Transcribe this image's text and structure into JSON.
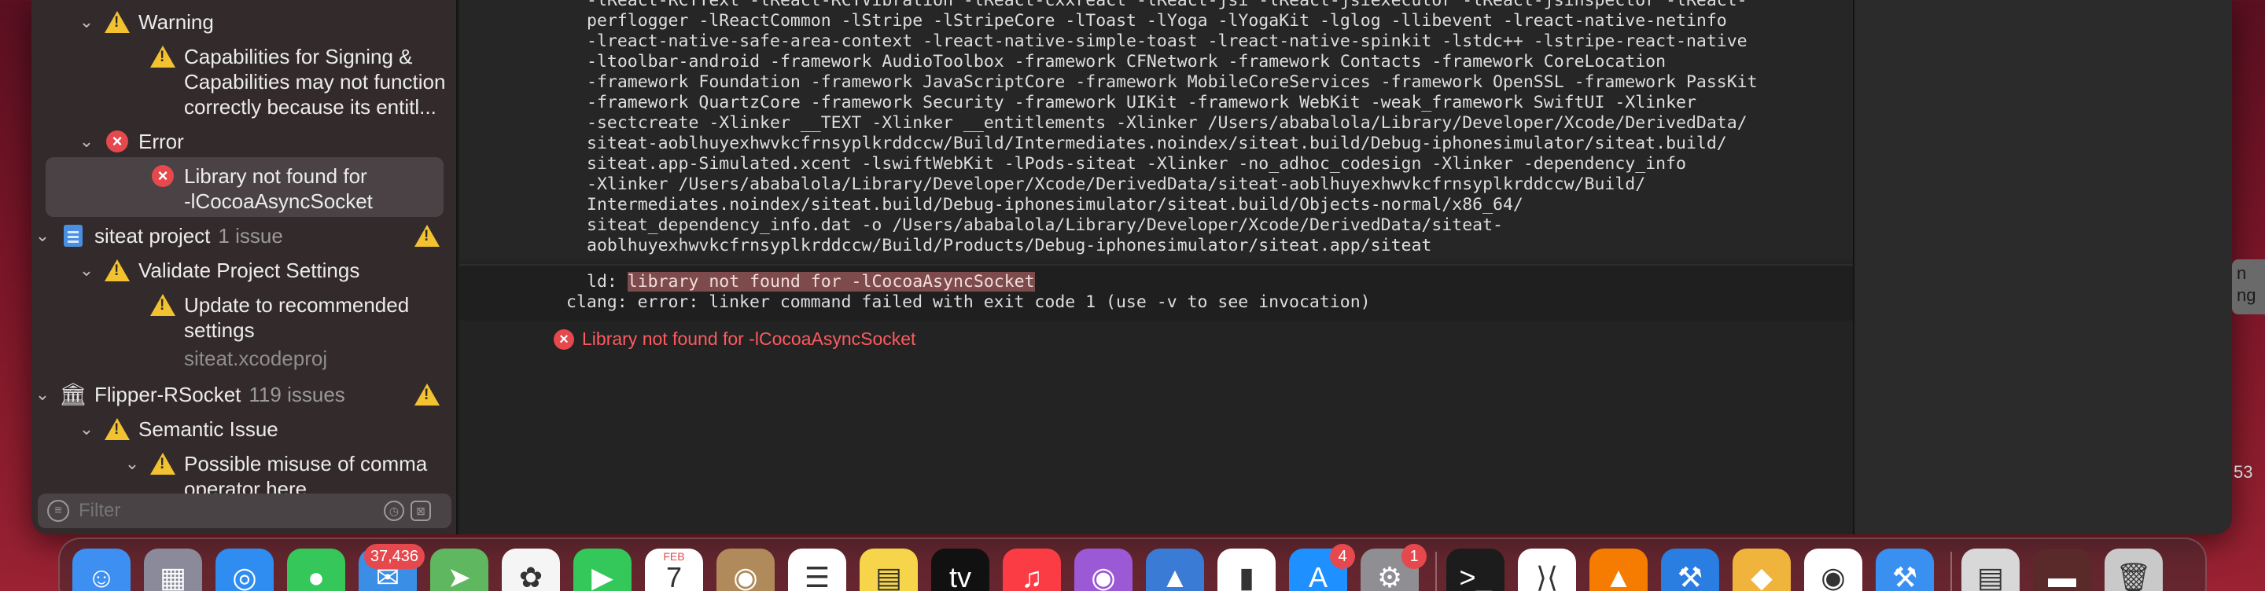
{
  "navigator": {
    "rows": [
      {
        "kind": "group",
        "chevron": "⌄",
        "icon": "warning-icon",
        "label": "Warning"
      },
      {
        "kind": "issue",
        "icon": "warning-icon",
        "lines": [
          "Capabilities for Signing &",
          "Capabilities may not function",
          "correctly because its entitl..."
        ]
      },
      {
        "kind": "group",
        "chevron": "⌄",
        "icon": "error-icon",
        "label": "Error"
      },
      {
        "kind": "issue",
        "icon": "error-icon",
        "lines": [
          "Library not found for",
          "-lCocoaAsyncSocket"
        ]
      },
      {
        "kind": "project",
        "chevron": "⌄",
        "icon": "document-icon",
        "label": "siteat project",
        "count": "1 issue"
      },
      {
        "kind": "group",
        "chevron": "⌄",
        "icon": "warning-icon",
        "label": "Validate Project Settings"
      },
      {
        "kind": "issue",
        "icon": "warning-icon",
        "lines": [
          "Update to recommended",
          "settings"
        ],
        "sub": "siteat.xcodeproj"
      },
      {
        "kind": "project",
        "chevron": "⌄",
        "icon": "bank-icon",
        "label": "Flipper-RSocket",
        "count": "119 issues"
      },
      {
        "kind": "group",
        "chevron": "⌄",
        "icon": "warning-icon",
        "label": "Semantic Issue"
      },
      {
        "kind": "issue",
        "chevron": "⌄",
        "icon": "warning-icon",
        "lines": [
          "Possible misuse of comma",
          "operator here"
        ]
      }
    ],
    "filter": {
      "placeholder": "Filter"
    }
  },
  "log": {
    "lines": [
      "-lReact-RCTText -lReact-RCTVibration -lReact-cxxreact -lReact-jsi -lReact-jsiexecutor -lReact-jsinspector -lReact-",
      "perflogger -lReactCommon -lStripe -lStripeCore -lToast -lYoga -lYogaKit -lglog -llibevent -lreact-native-netinfo",
      "-lreact-native-safe-area-context -lreact-native-simple-toast -lreact-native-spinkit -lstdc++ -lstripe-react-native",
      "-ltoolbar-android -framework AudioToolbox -framework CFNetwork -framework Contacts -framework CoreLocation",
      "-framework Foundation -framework JavaScriptCore -framework MobileCoreServices -framework OpenSSL -framework PassKit",
      "-framework QuartzCore -framework Security -framework UIKit -framework WebKit -weak_framework SwiftUI -Xlinker",
      "-sectcreate -Xlinker __TEXT -Xlinker __entitlements -Xlinker /Users/ababalola/Library/Developer/Xcode/DerivedData/",
      "siteat-aoblhuyexhwvkcfrnsyplkrddccw/Build/Intermediates.noindex/siteat.build/Debug-iphonesimulator/siteat.build/",
      "siteat.app-Simulated.xcent -lswiftWebKit -lPods-siteat -Xlinker -no_adhoc_codesign -Xlinker -dependency_info",
      "-Xlinker /Users/ababalola/Library/Developer/Xcode/DerivedData/siteat-aoblhuyexhwvkcfrnsyplkrddccw/Build/",
      "Intermediates.noindex/siteat.build/Debug-iphonesimulator/siteat.build/Objects-normal/x86_64/",
      "siteat_dependency_info.dat -o /Users/ababalola/Library/Developer/Xcode/DerivedData/siteat-",
      "aoblhuyexhwvkcfrnsyplkrddccw/Build/Products/Debug-iphonesimulator/siteat.app/siteat"
    ],
    "ld_prefix": "ld: ",
    "ld_highlight": "library not found for -lCocoaAsyncSocket",
    "clang_line": "clang: error: linker command failed with exit code 1 (use -v to see invocation)",
    "error_summary": "Library not found for -lCocoaAsyncSocket"
  },
  "edge": {
    "peek_lines": [
      "n",
      "ng"
    ],
    "number": "53"
  },
  "dock": {
    "apps": [
      {
        "name": "finder-icon",
        "color": "#3d8ff2",
        "glyph": "☺"
      },
      {
        "name": "launchpad-icon",
        "color": "#8a8a9a",
        "glyph": "▦"
      },
      {
        "name": "safari-icon",
        "color": "#2f8cf0",
        "glyph": "◎"
      },
      {
        "name": "messages-icon",
        "color": "#35c759",
        "glyph": "●"
      },
      {
        "name": "mail-icon",
        "color": "#3a8ee6",
        "glyph": "✉",
        "badge": "37,436"
      },
      {
        "name": "maps-icon",
        "color": "#5fb85f",
        "glyph": "➤"
      },
      {
        "name": "photos-icon",
        "color": "#f5f5f5",
        "glyph": "✿"
      },
      {
        "name": "facetime-icon",
        "color": "#34c759",
        "glyph": "▶"
      },
      {
        "name": "calendar-icon",
        "color": "#ffffff",
        "glyph": "7",
        "caption": "FEB"
      },
      {
        "name": "contacts-icon",
        "color": "#b08a5a",
        "glyph": "◉"
      },
      {
        "name": "reminders-icon",
        "color": "#ffffff",
        "glyph": "☰"
      },
      {
        "name": "notes-icon",
        "color": "#f7d54a",
        "glyph": "▤"
      },
      {
        "name": "appletv-icon",
        "color": "#111111",
        "glyph": "tv"
      },
      {
        "name": "music-icon",
        "color": "#fc3c44",
        "glyph": "♫"
      },
      {
        "name": "podcasts-icon",
        "color": "#9b59d6",
        "glyph": "◉"
      },
      {
        "name": "keynote-icon",
        "color": "#3a7bd5",
        "glyph": "▲"
      },
      {
        "name": "numbers-icon",
        "color": "#ffffff",
        "glyph": "▮"
      },
      {
        "name": "appstore-icon",
        "color": "#1e90ff",
        "glyph": "A",
        "badge": "4"
      },
      {
        "name": "system-settings-icon",
        "color": "#8e8e93",
        "glyph": "⚙",
        "badge": "1"
      },
      {
        "name": "terminal-icon",
        "color": "#1c1c1c",
        "glyph": ">_"
      },
      {
        "name": "vscode-icon",
        "color": "#ffffff",
        "glyph": "⟩⟨"
      },
      {
        "name": "vlc-icon",
        "color": "#f57c00",
        "glyph": "▲"
      },
      {
        "name": "xcode-store-icon",
        "color": "#2a7de1",
        "glyph": "⚒"
      },
      {
        "name": "cyberduck-icon",
        "color": "#f0b43c",
        "glyph": "◆"
      },
      {
        "name": "chrome-icon",
        "color": "#ffffff",
        "glyph": "◉"
      },
      {
        "name": "xcode-icon",
        "color": "#3a90f0",
        "glyph": "⚒"
      },
      {
        "name": "documents-icon",
        "color": "#d8d8d8",
        "glyph": "▤"
      },
      {
        "name": "downloads-stack-icon",
        "color": "#5a2a2a",
        "glyph": "▬"
      },
      {
        "name": "trash-icon",
        "color": "#c9c9c9",
        "glyph": "🗑"
      }
    ]
  }
}
